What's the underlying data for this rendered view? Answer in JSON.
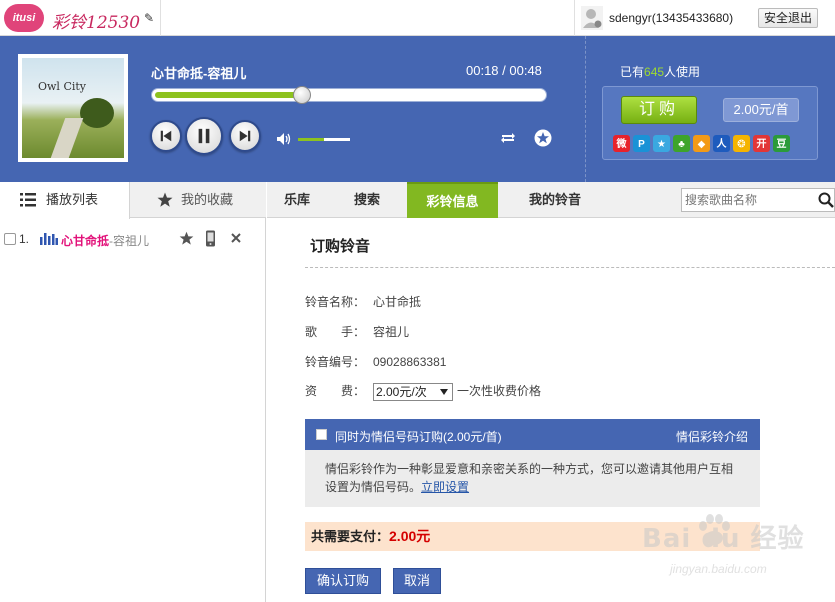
{
  "topbar": {
    "logo_badge": "itusi",
    "logo_text": "彩铃12530",
    "username": "sdengyr(13435433680)",
    "logout_label": "安全退出"
  },
  "player": {
    "cover_text": "Owl City",
    "song_title": "心甘命抵-容祖儿",
    "time": "00:18 / 00:48",
    "progress_fraction": 0.375,
    "volume_fraction": 0.5,
    "users_prefix": "已有",
    "users_count": "645",
    "users_suffix": "人使用",
    "buy_label": "订购",
    "price_label": "2.00元/首",
    "share_icons": [
      "sina-icon",
      "qzone-icon",
      "renren-icon",
      "clover-icon",
      "box-icon",
      "people-icon",
      "kaixin-icon",
      "kai-icon",
      "douban-icon"
    ],
    "share_glyphs": [
      "微",
      "P",
      "★",
      "♣",
      "◆",
      "人",
      "❂",
      "开",
      "豆"
    ],
    "share_colors": [
      "#e8222b",
      "#1a92d6",
      "#3aa8e0",
      "#3ea42a",
      "#f39a16",
      "#1e5bbd",
      "#f5b400",
      "#e23636",
      "#2b9b3a"
    ]
  },
  "left": {
    "tab_playlist": "播放列表",
    "tab_favorites": "我的收藏",
    "playlist": [
      {
        "index": "1.",
        "song": "心甘命抵",
        "artist": "-容祖儿"
      }
    ]
  },
  "nav": {
    "tabs": [
      {
        "label": "乐库"
      },
      {
        "label": "搜索"
      },
      {
        "label": "彩铃信息"
      },
      {
        "label": "我的铃音"
      }
    ],
    "search_placeholder": "搜索歌曲名称"
  },
  "order": {
    "title": "订购铃音",
    "name_label": "铃音名称：",
    "name_value": "心甘命抵",
    "artist_label": "歌　　手：",
    "artist_value": "容祖儿",
    "code_label": "铃音编号：",
    "code_value": "09028863381",
    "fee_label": "资　　费：",
    "fee_selected": "2.00元/次",
    "fee_note": "一次性收费价格",
    "couple_label": "同时为情侣号码订购(2.00元/首)",
    "couple_intro": "情侣彩铃介绍",
    "couple_desc": "情侣彩铃作为一种彰显爱意和亲密关系的一种方式，您可以邀请其他用户互相设置为情侣号码。",
    "couple_link": "立即设置",
    "total_label": "共需要支付：",
    "total_amount": "2.00元",
    "confirm_label": "确认订购",
    "cancel_label": "取消"
  },
  "watermark": {
    "brand": "Bai du 经验",
    "sub": "jingyan.baidu.com"
  },
  "colors": {
    "primary_blue": "#4566b2",
    "accent_green": "#82b821",
    "highlight_pink": "#e2127a",
    "price_red": "#d40000"
  }
}
